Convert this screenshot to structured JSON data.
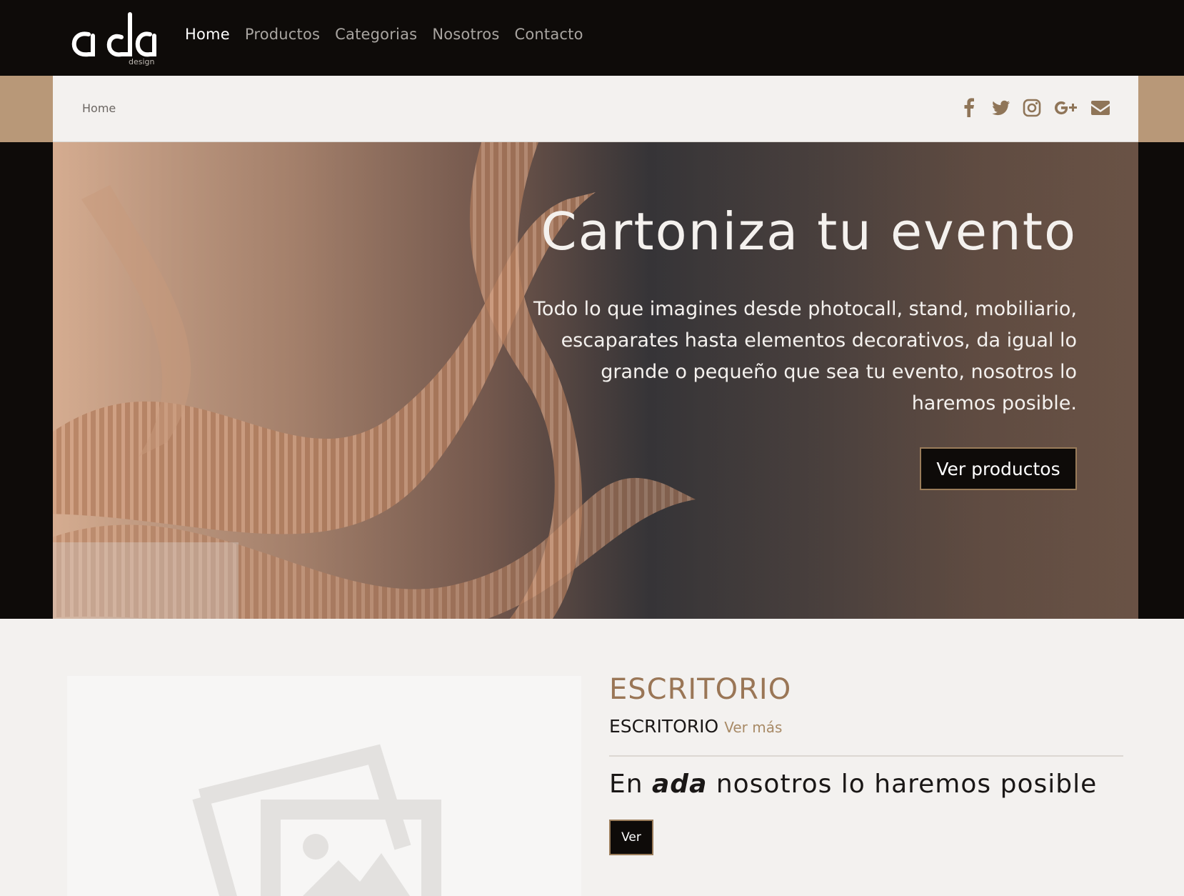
{
  "header": {
    "logo_text": "ada",
    "logo_sub": "design",
    "nav": [
      {
        "label": "Home",
        "active": true
      },
      {
        "label": "Productos",
        "active": false
      },
      {
        "label": "Categorias",
        "active": false
      },
      {
        "label": "Nosotros",
        "active": false
      },
      {
        "label": "Contacto",
        "active": false
      }
    ]
  },
  "breadcrumb": {
    "current": "Home"
  },
  "socials": [
    "facebook-icon",
    "twitter-icon",
    "instagram-icon",
    "google-plus-icon",
    "envelope-icon"
  ],
  "hero": {
    "title": "Cartoniza tu evento",
    "text": "Todo lo que imagines desde photocall, stand, mobiliario, escaparates hasta elementos decorativos, da igual lo grande o pequeño que sea tu evento, nosotros lo haremos posible.",
    "button": "Ver productos"
  },
  "category": {
    "heading": "ESCRITORIO",
    "subtitle": "ESCRITORIO",
    "more_link": "Ver más",
    "tagline_before": "En",
    "tagline_brand": "ada",
    "tagline_after": "nosotros lo haremos posible",
    "button": "Ver"
  },
  "colors": {
    "dark": "#0e0b09",
    "tan": "#b89878",
    "accent_brown": "#9a7656",
    "background": "#f3f1ef"
  }
}
